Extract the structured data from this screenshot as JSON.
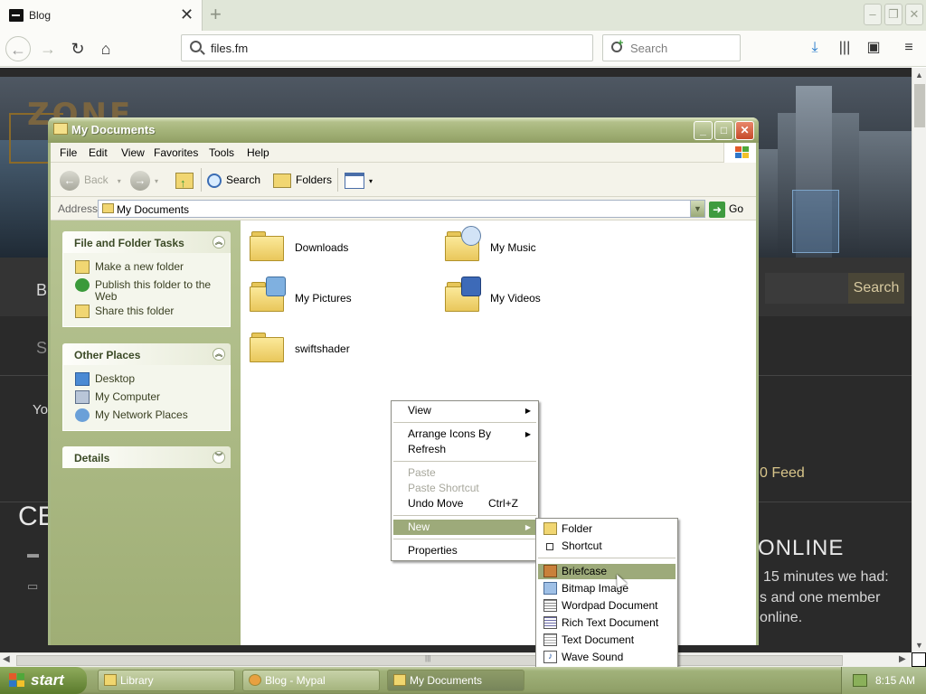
{
  "browser": {
    "tab_title": "Blog",
    "new_tab": "+",
    "close_tab": "✕",
    "url": "files.fm",
    "search_placeholder": "Search"
  },
  "website": {
    "search_button": "Search",
    "feed_text": "0 Feed",
    "online_heading": "ONLINE",
    "online_line1": "15 minutes we had:",
    "online_line2": "s and one member",
    "online_line3": "online.",
    "frag_b": "B",
    "frag_s": "S",
    "frag_yo": "Yo",
    "frag_ce": "CE"
  },
  "explorer": {
    "title": "My Documents",
    "menu": [
      "File",
      "Edit",
      "View",
      "Favorites",
      "Tools",
      "Help"
    ],
    "toolbar": {
      "back": "Back",
      "search": "Search",
      "folders": "Folders"
    },
    "address_label": "Address",
    "address_value": "My Documents",
    "go_label": "Go",
    "file_tasks": {
      "title": "File and Folder Tasks",
      "items": [
        "Make a new folder",
        "Publish this folder to the Web",
        "Share this folder"
      ]
    },
    "other_places": {
      "title": "Other Places",
      "items": [
        "Desktop",
        "My Computer",
        "My Network Places"
      ]
    },
    "details_title": "Details",
    "files": [
      "Downloads",
      "My Music",
      "My Pictures",
      "My Videos",
      "swiftshader"
    ]
  },
  "context_menu": {
    "items": [
      {
        "label": "View",
        "submenu": true
      },
      {
        "label": "Arrange Icons By",
        "submenu": true
      },
      {
        "label": "Refresh"
      },
      {
        "label": "Paste",
        "disabled": true
      },
      {
        "label": "Paste Shortcut",
        "disabled": true
      },
      {
        "label": "Undo Move",
        "shortcut": "Ctrl+Z"
      },
      {
        "label": "New",
        "submenu": true,
        "selected": true
      },
      {
        "label": "Properties"
      }
    ]
  },
  "new_submenu": {
    "items": [
      {
        "label": "Folder",
        "icon": "folder-icon"
      },
      {
        "label": "Shortcut",
        "icon": "shortcut-icon"
      },
      {
        "label": "Briefcase",
        "icon": "briefcase-icon",
        "selected": true
      },
      {
        "label": "Bitmap Image",
        "icon": "bitmap-icon"
      },
      {
        "label": "Wordpad Document",
        "icon": "wordpad-icon"
      },
      {
        "label": "Rich Text Document",
        "icon": "rtf-icon"
      },
      {
        "label": "Text Document",
        "icon": "text-document-icon"
      },
      {
        "label": "Wave Sound",
        "icon": "wave-sound-icon"
      }
    ]
  },
  "taskbar": {
    "start": "start",
    "tasks": [
      "Library",
      "Blog - Mypal",
      "My Documents"
    ],
    "clock": "8:15 AM"
  },
  "colors": {
    "xp_olive_title": "#a5b47a",
    "menu_selection": "#9daa7a",
    "site_accent": "#d8c58a"
  }
}
